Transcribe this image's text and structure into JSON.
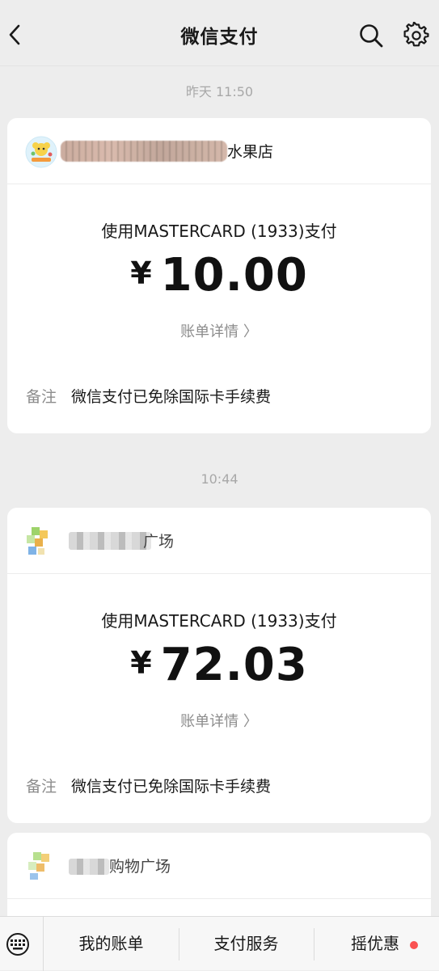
{
  "header": {
    "title": "微信支付"
  },
  "messages": [
    {
      "time": "昨天 11:50",
      "merchant_visible": "水果店",
      "pay_method": "使用MASTERCARD (1933)支付",
      "currency": "¥",
      "amount": "10.00",
      "details_link": "账单详情 〉",
      "remark_label": "备注",
      "remark_text": "微信支付已免除国际卡手续费"
    },
    {
      "time": "10:44",
      "merchant_visible": "广场",
      "pay_method": "使用MASTERCARD (1933)支付",
      "currency": "¥",
      "amount": "72.03",
      "details_link": "账单详情 〉",
      "remark_label": "备注",
      "remark_text": "微信支付已免除国际卡手续费"
    },
    {
      "merchant_visible": "购物广场"
    }
  ],
  "bottom_menu": {
    "items": [
      "我的账单",
      "支付服务",
      "摇优惠"
    ]
  },
  "colors": {
    "background": "#ededed",
    "card": "#ffffff",
    "badge": "#fa5151"
  }
}
